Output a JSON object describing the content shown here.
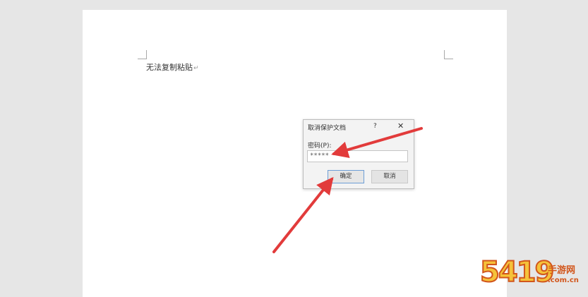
{
  "document": {
    "text": "无法复制粘贴",
    "paragraph_mark": "↵"
  },
  "dialog": {
    "title": "取消保护文档",
    "help": "?",
    "close": "✕",
    "password_label": "密码(P):",
    "password_value": "*****",
    "ok_label": "确定",
    "cancel_label": "取消"
  },
  "watermark": {
    "number": "5419",
    "name": "手游网",
    "url": ".com.cn"
  },
  "colors": {
    "arrow": "#e23b3b",
    "focus_border": "#6d9ed6"
  }
}
